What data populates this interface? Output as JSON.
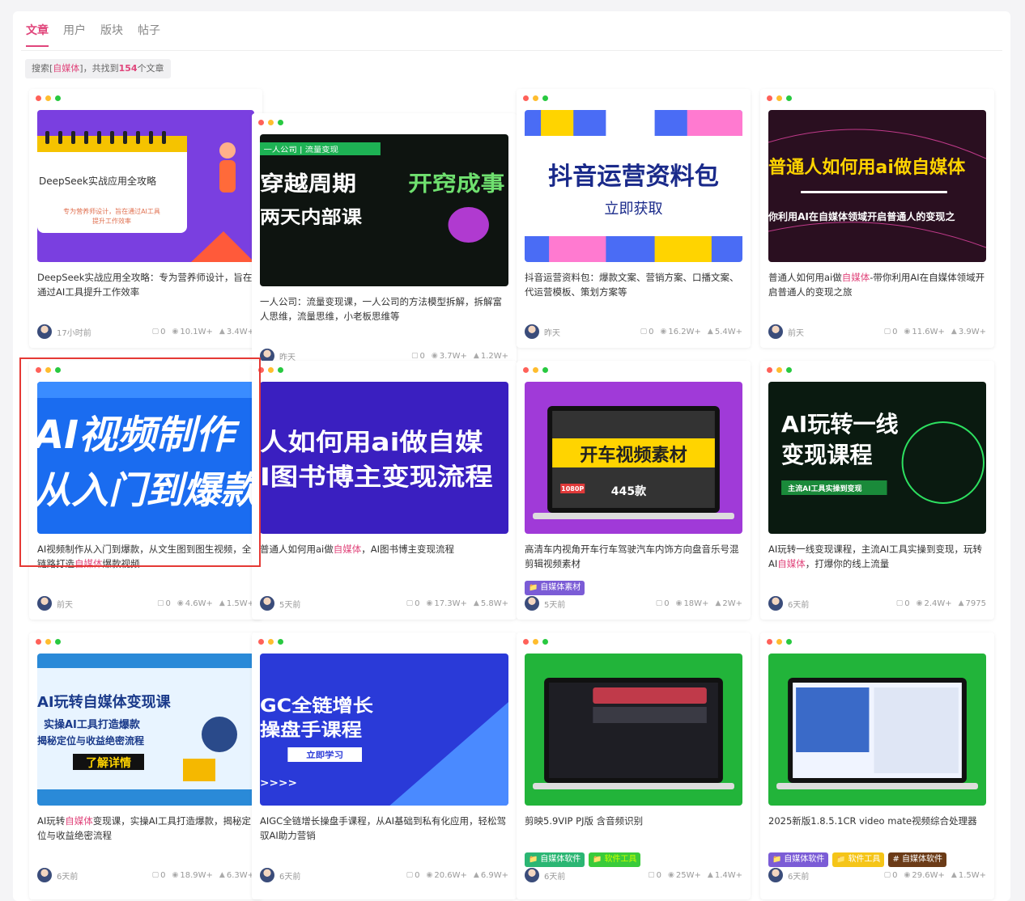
{
  "tabs": [
    "文章",
    "用户",
    "版块",
    "帖子"
  ],
  "active_tab": 0,
  "notice": {
    "prefix": "搜索[",
    "keyword": "自媒体",
    "mid": "]，共找到",
    "count": "154",
    "suffix": "个文章"
  },
  "icons": {
    "comment": "comment-icon",
    "view": "eye-icon",
    "like": "thumb-up-icon"
  },
  "colors": {
    "accent": "#e0457b"
  },
  "cards": [
    {
      "title_a": "DeepSeek实战应用全攻略：专为营养师设计，旨在通过AI工具提升工作效率",
      "kw": "",
      "title_b": "",
      "time": "17小时前",
      "comments": "0",
      "views": "10.1W+",
      "likes": "3.4W+",
      "thumb": "deepseek",
      "thumb_text": [
        "DeepSeek实战应用全攻略",
        "专为营养师设计，旨在通过AI工具",
        "提升工作效率"
      ],
      "tags": []
    },
    {
      "title_a": "一人公司：流量变现课，一人公司的方法模型拆解，拆解富人思维，流量思维，小老板思维等",
      "kw": "",
      "title_b": "",
      "time": "昨天",
      "comments": "0",
      "views": "3.7W+",
      "likes": "1.2W+",
      "thumb": "liuliang",
      "thumb_text": [
        "一人公司 | 流量变现",
        "穿越周期",
        "开窍成事",
        "两天内部课"
      ],
      "tags": []
    },
    {
      "title_a": "抖音运营资料包：爆款文案、营销方案、口播文案、代运营模板、策划方案等",
      "kw": "",
      "title_b": "",
      "time": "昨天",
      "comments": "0",
      "views": "16.2W+",
      "likes": "5.4W+",
      "thumb": "douyin",
      "thumb_text": [
        "抖音运营资料包",
        "立即获取"
      ],
      "tags": []
    },
    {
      "title_a": "普通人如何用ai做",
      "kw": "自媒体",
      "title_b": "-带你利用AI在自媒体领域开启普通人的变现之旅",
      "time": "前天",
      "comments": "0",
      "views": "11.6W+",
      "likes": "3.9W+",
      "thumb": "putong",
      "thumb_text": [
        "普通人如何用ai做自媒体",
        "你利用AI在自媒体领域开启普通人的变现之"
      ],
      "tags": []
    },
    {
      "title_a": "AI视频制作从入门到爆款，从文生图到图生视频，全链路打造",
      "kw": "自媒体",
      "title_b": "爆款视频",
      "time": "前天",
      "comments": "0",
      "views": "4.6W+",
      "likes": "1.5W+",
      "thumb": "aivideo",
      "thumb_text": [
        "AI视频制作",
        "从入门到爆款"
      ],
      "tags": []
    },
    {
      "title_a": "普通人如何用ai做",
      "kw": "自媒体",
      "title_b": "，AI图书博主变现流程",
      "time": "5天前",
      "comments": "0",
      "views": "17.3W+",
      "likes": "5.8W+",
      "thumb": "tushu",
      "thumb_text": [
        "人如何用ai做自媒",
        "I图书博主变现流程"
      ],
      "tags": []
    },
    {
      "title_a": "高清车内视角开车行车驾驶汽车内饰方向盘音乐号混剪辑视频素材",
      "kw": "",
      "title_b": "",
      "time": "5天前",
      "comments": "0",
      "views": "18W+",
      "likes": "2W+",
      "thumb": "kaiche",
      "thumb_text": [
        "开车视频素材",
        "445款",
        "1080P"
      ],
      "tags": [
        {
          "label": "自媒体素材",
          "style": "tag-purple",
          "icon": "folder-icon"
        }
      ]
    },
    {
      "title_a": "AI玩转一线变现课程，主流AI工具实操到变现，玩转AI",
      "kw": "自媒体",
      "title_b": "，打爆你的线上流量",
      "time": "6天前",
      "comments": "0",
      "views": "2.4W+",
      "likes": "7975",
      "thumb": "yixian",
      "thumb_text": [
        "AI玩转一线",
        "变现课程",
        "主流AI工具实操到变现"
      ],
      "tags": []
    },
    {
      "title_a": "AI玩转",
      "kw": "自媒体",
      "title_b": "变现课，实操AI工具打造爆款，揭秘定位与收益绝密流程",
      "time": "6天前",
      "comments": "0",
      "views": "18.9W+",
      "likes": "6.3W+",
      "thumb": "wanzhuan",
      "thumb_text": [
        "AI玩转自媒体变现课",
        "实操AI工具打造爆款",
        "揭秘定位与收益绝密流程",
        "了解详情"
      ],
      "tags": []
    },
    {
      "title_a": "AIGC全链增长操盘手课程，从AI基础到私有化应用，轻松驾驭AI助力营销",
      "kw": "",
      "title_b": "",
      "time": "6天前",
      "comments": "0",
      "views": "20.6W+",
      "likes": "6.9W+",
      "thumb": "aigc",
      "thumb_text": [
        "GC全链增长",
        "操盘手课程",
        "立即学习",
        ">>>>"
      ],
      "tags": []
    },
    {
      "title_a": "剪映5.9VIP PJ版 含音频识别",
      "kw": "",
      "title_b": "",
      "time": "6天前",
      "comments": "0",
      "views": "25W+",
      "likes": "1.4W+",
      "thumb": "jianying",
      "thumb_text": [],
      "tags": [
        {
          "label": "自媒体软件",
          "style": "tag-green",
          "icon": "folder-icon"
        },
        {
          "label": "软件工具",
          "style": "tag-lime",
          "icon": "folder-icon"
        }
      ]
    },
    {
      "title_a": "2025新版1.8.5.1CR video mate视频综合处理器",
      "kw": "",
      "title_b": "",
      "time": "6天前",
      "comments": "0",
      "views": "29.6W+",
      "likes": "1.5W+",
      "thumb": "videomate",
      "thumb_text": [],
      "tags": [
        {
          "label": "自媒体软件",
          "style": "tag-purple",
          "icon": "folder-icon"
        },
        {
          "label": "软件工具",
          "style": "tag-yellow",
          "icon": "folder-icon"
        },
        {
          "label": "# 自媒体软件",
          "style": "tag-brown",
          "icon": ""
        }
      ]
    }
  ]
}
